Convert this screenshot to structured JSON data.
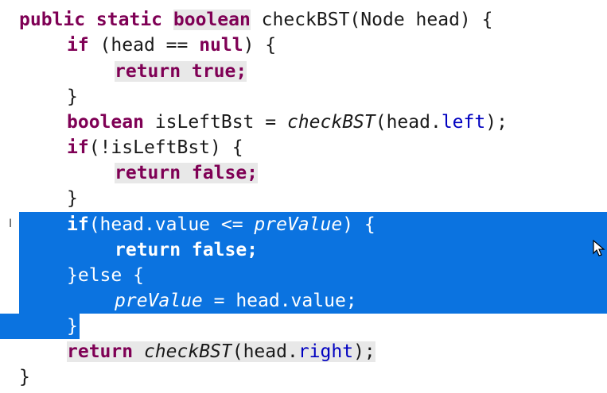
{
  "code": {
    "lines": [
      [
        {
          "t": "public static ",
          "c": "kw"
        },
        {
          "t": "boolean",
          "c": "kw mark"
        },
        {
          "t": " checkBST(Node "
        },
        {
          "t": "head"
        },
        {
          "t": ") {"
        }
      ],
      [
        {
          "t": "if",
          "c": "kw"
        },
        {
          "t": " ("
        },
        {
          "t": "head"
        },
        {
          "t": " == "
        },
        {
          "t": "null",
          "c": "kw"
        },
        {
          "t": ") {"
        }
      ],
      [
        {
          "t": "return true;",
          "c": "kw mark"
        }
      ],
      [
        {
          "t": "}"
        }
      ],
      [
        {
          "t": "boolean",
          "c": "kw"
        },
        {
          "t": " isLeftBst = "
        },
        {
          "t": "checkBST",
          "c": "it"
        },
        {
          "t": "(head."
        },
        {
          "t": "left",
          "c": "fld"
        },
        {
          "t": ");"
        }
      ],
      [
        {
          "t": "if",
          "c": "kw"
        },
        {
          "t": "(!isLeftBst) {"
        }
      ],
      [
        {
          "t": "return false;",
          "c": "kw mark"
        }
      ],
      [
        {
          "t": "}"
        }
      ],
      [
        {
          "t": "if",
          "c": "kw"
        },
        {
          "t": "(head.value <= "
        },
        {
          "t": "preValue",
          "c": "it"
        },
        {
          "t": ") {"
        }
      ],
      [
        {
          "t": "return false;",
          "c": "ret"
        }
      ],
      [
        {
          "t": "}else {",
          "c": ""
        }
      ],
      [
        {
          "t": "preValue",
          "c": "it"
        },
        {
          "t": " = head.value;"
        }
      ],
      [
        {
          "t": "}"
        }
      ],
      [
        {
          "t": "return",
          "c": "kw mark"
        },
        {
          "t": " ",
          "c": "mark"
        },
        {
          "t": "checkBST",
          "c": "it mark"
        },
        {
          "t": "(head.",
          "c": "mark"
        },
        {
          "t": "right",
          "c": "fld mark"
        },
        {
          "t": ");",
          "c": "mark"
        }
      ],
      [
        {
          "t": "}"
        }
      ]
    ]
  },
  "icons": {
    "text_cursor": "I",
    "mouse_pointer": "arrow-pointer-icon"
  },
  "colors": {
    "selection": "#0b73e0",
    "keyword": "#7f0055",
    "field": "#0000c0",
    "occurrence_mark": "#e8e8e8"
  }
}
